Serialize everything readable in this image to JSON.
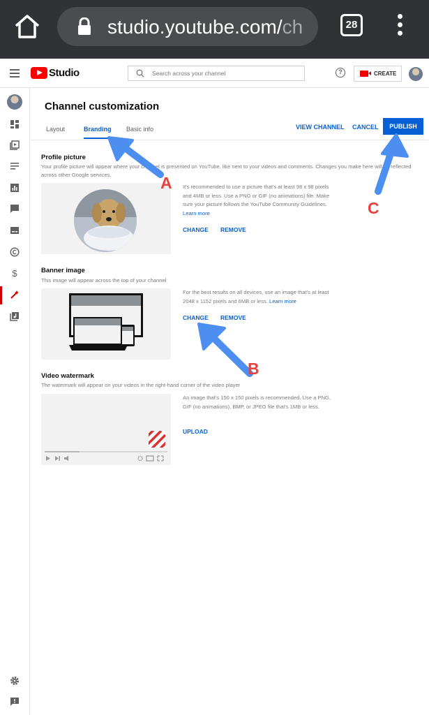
{
  "browser": {
    "url_main": "studio.youtube.com/",
    "url_faded": "ch",
    "tab_count": "28"
  },
  "header": {
    "logo_text": "Studio",
    "search_placeholder": "Search across your channel",
    "create_label": "CREATE"
  },
  "page": {
    "title": "Channel customization",
    "tabs": [
      {
        "label": "Layout"
      },
      {
        "label": "Branding",
        "active": true
      },
      {
        "label": "Basic info"
      }
    ],
    "view_channel": "VIEW CHANNEL",
    "cancel": "CANCEL",
    "publish": "PUBLISH"
  },
  "profile": {
    "title": "Profile picture",
    "desc": "Your profile picture will appear where your channel is presented on YouTube, like next to your videos and comments. Changes you make here will be reflected across other Google services.",
    "info": "It's recommended to use a picture that's at least 98 x 98 pixels and 4MB or less. Use a PNG or GIF (no animations) file. Make sure your picture follows the YouTube Community Guidelines.",
    "learn_more": "Learn more",
    "change": "CHANGE",
    "remove": "REMOVE"
  },
  "banner": {
    "title": "Banner image",
    "desc": "This image will appear across the top of your channel",
    "info": "For the best results on all devices, use an image that's at least 2048 x 1152 pixels and 6MB or less.",
    "learn_more": "Learn more",
    "change": "CHANGE",
    "remove": "REMOVE"
  },
  "watermark": {
    "title": "Video watermark",
    "desc": "The watermark will appear on your videos in the right-hand corner of the video player",
    "info": "An image that's 150 x 150 pixels is recommended. Use a PNG, GIF (no animations), BMP, or JPEG file that's 1MB or less.",
    "upload": "UPLOAD"
  },
  "annotations": {
    "a": "A",
    "b": "B",
    "c": "C",
    "arrow_color": "#4d8ff0",
    "label_color": "#e9423e"
  },
  "colors": {
    "accent": "#065fd4",
    "brand_red": "#ff0000"
  }
}
